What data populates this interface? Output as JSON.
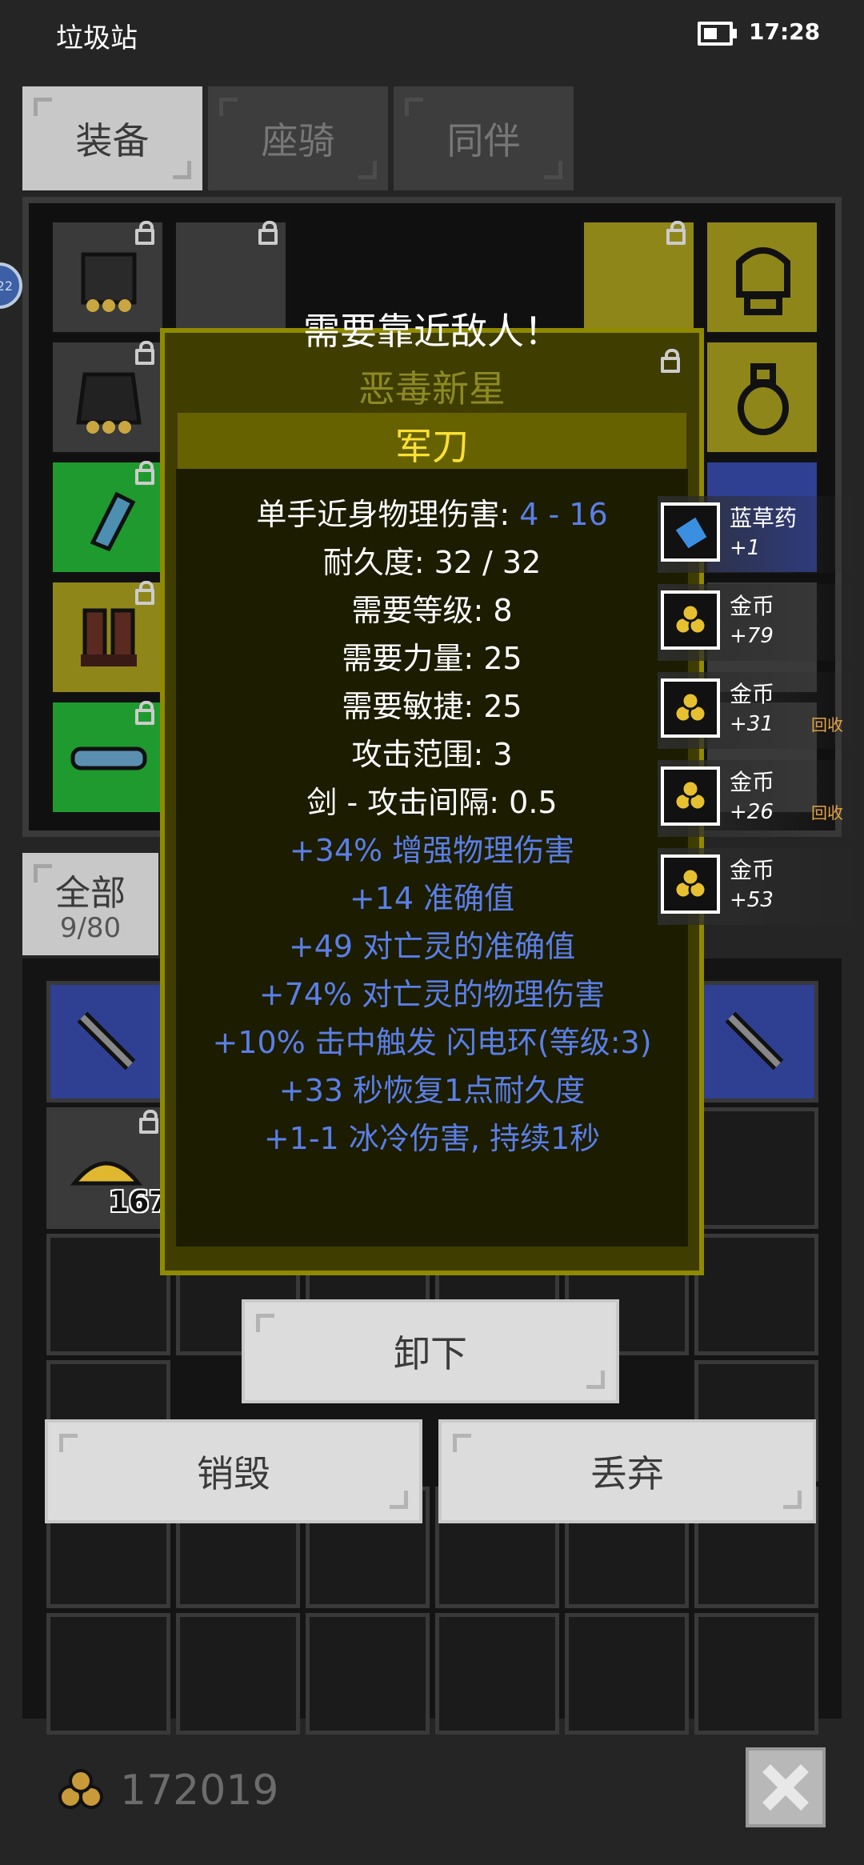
{
  "status_bar": {
    "app_name": "垃圾站",
    "time": "17:28",
    "battery_level": 0.5
  },
  "tabs": [
    {
      "label": "装备",
      "active": true
    },
    {
      "label": "座骑",
      "active": false
    },
    {
      "label": "同伴",
      "active": false
    }
  ],
  "side_badge": "22",
  "tooltip": {
    "warning": "需要靠近敌人！",
    "set_name": "恶毒新星",
    "item_name": "军刀",
    "damage_label": "单手近身物理伤害: ",
    "damage_value": "4 - 16",
    "stats": [
      "耐久度: 32 / 32",
      "需要等级: 8",
      "需要力量: 25",
      "需要敏捷: 25",
      "攻击范围: 3",
      "剑 - 攻击间隔: 0.5"
    ],
    "affixes": [
      "+34% 增强物理伤害",
      "+14 准确值",
      "+49 对亡灵的准确值",
      "+74% 对亡灵的物理伤害",
      "+10% 击中触发 闪电环(等级:3)",
      "+33 秒恢复1点耐久度",
      "+1-1 冰冷伤害, 持续1秒"
    ]
  },
  "pickups": [
    {
      "name": "蓝草药",
      "amount": "+1",
      "icon": "blue-herb-icon",
      "recycle": ""
    },
    {
      "name": "金币",
      "amount": "+79",
      "icon": "gold-coin-icon",
      "recycle": ""
    },
    {
      "name": "金币",
      "amount": "+31",
      "icon": "gold-coin-icon",
      "recycle": "回收"
    },
    {
      "name": "金币",
      "amount": "+26",
      "icon": "gold-coin-icon",
      "recycle": "回收"
    },
    {
      "name": "金币",
      "amount": "+53",
      "icon": "gold-coin-icon",
      "recycle": ""
    }
  ],
  "inventory": {
    "filter_label": "全部",
    "count": "9/80",
    "gold_pile_count": "167"
  },
  "buttons": {
    "unequip": "卸下",
    "destroy": "销毁",
    "discard": "丢弃"
  },
  "gold_total": "172019",
  "colors": {
    "accent_blue": "#5a7fe6",
    "item_name_yellow": "#ffe033",
    "set_name": "#8d8a24",
    "recycle": "#e6a440"
  }
}
